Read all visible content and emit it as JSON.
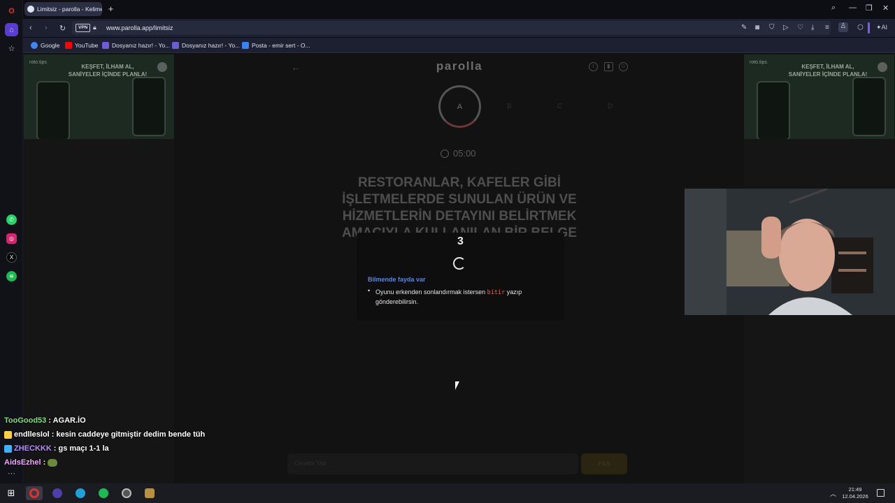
{
  "browser": {
    "tab_title": "Limitsiz - parolla - Kelime",
    "url": "www.parolla.app/limitsiz",
    "vpn_label": "VPN",
    "ai_label": "AI"
  },
  "bookmarks": [
    {
      "label": "Google",
      "color": "#4285f4"
    },
    {
      "label": "YouTube",
      "color": "#ff0000"
    },
    {
      "label": "Dosyanız hazır! - Yo...",
      "color": "#6e5bd6"
    },
    {
      "label": "Dosyanız hazır! - Yo...",
      "color": "#6e5bd6"
    },
    {
      "label": "Posta - emir sert - O...",
      "color": "#3b82f6"
    }
  ],
  "ads": {
    "brand": "roto.tips",
    "headline_1": "KEŞFET, İLHAM AL,",
    "headline_2": "SANİYELER İÇİNDE PLANLA!"
  },
  "game": {
    "logo": "parolla",
    "current_letter": "A",
    "ghost_letters": [
      "B",
      "C",
      "D"
    ],
    "timer": "05:00",
    "question": "RESTORANLAR, KAFELER GİBİ İŞLETMELERDE SUNULAN ÜRÜN VE HİZMETLERİN DETAYINI BELİRTMEK AMACIYLA KULLANILAN BİR BELGE TÜRÜ",
    "answer_placeholder": "Cevabı Yaz",
    "pass_label": "PAS"
  },
  "modal": {
    "countdown": "3",
    "tip_title": "Bilmende fayda var",
    "tip_before": "Oyunu erkenden sonlandırmak istersen",
    "tip_code": "bitir",
    "tip_after": "yazıp gönderebilirsin."
  },
  "chat": [
    {
      "user": "TooGood53",
      "message": ": AGAR.İO",
      "user_color": "#7ee07e"
    },
    {
      "user": "endllesIol",
      "message": ": kesin caddeye gitmiştir dedim bende tüh",
      "user_color": "#e0e0e0"
    },
    {
      "user": "ZHECKKK",
      "message": ": gs maçı 1-1 la",
      "user_color": "#b88cff"
    },
    {
      "user": "AidsEzhel",
      "message": ":",
      "user_color": "#f2a8ff"
    }
  ],
  "taskbar": {
    "time": "21:49",
    "date": "12.04.2026"
  },
  "colors": {
    "accent_blue": "#5b86d8",
    "code_red": "#d76a6a"
  }
}
